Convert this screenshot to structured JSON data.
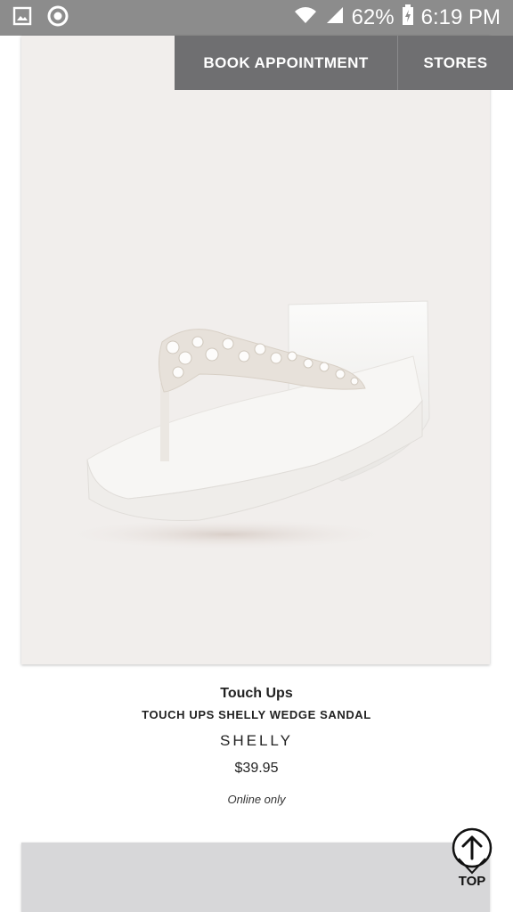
{
  "status_bar": {
    "battery": "62%",
    "time": "6:19 PM",
    "icons": [
      "gallery-icon",
      "sync-icon",
      "wifi-icon",
      "signal-icon",
      "battery-charging-icon"
    ]
  },
  "actions": {
    "book_label": "BOOK APPOINTMENT",
    "stores_label": "STORES"
  },
  "product": {
    "brand": "Touch Ups",
    "name": "TOUCH UPS SHELLY WEDGE SANDAL",
    "style": "SHELLY",
    "price": "$39.95",
    "availability": "Online only",
    "image": "white-jeweled-wedge-flip-flop-sandal"
  },
  "back_to_top": {
    "label": "TOP",
    "icon": "arrow-up-circle-icon"
  },
  "colors": {
    "status_bar": "#8c8c8c",
    "action_bar": "#6f6f71",
    "image_bg": "#f1eeec"
  }
}
